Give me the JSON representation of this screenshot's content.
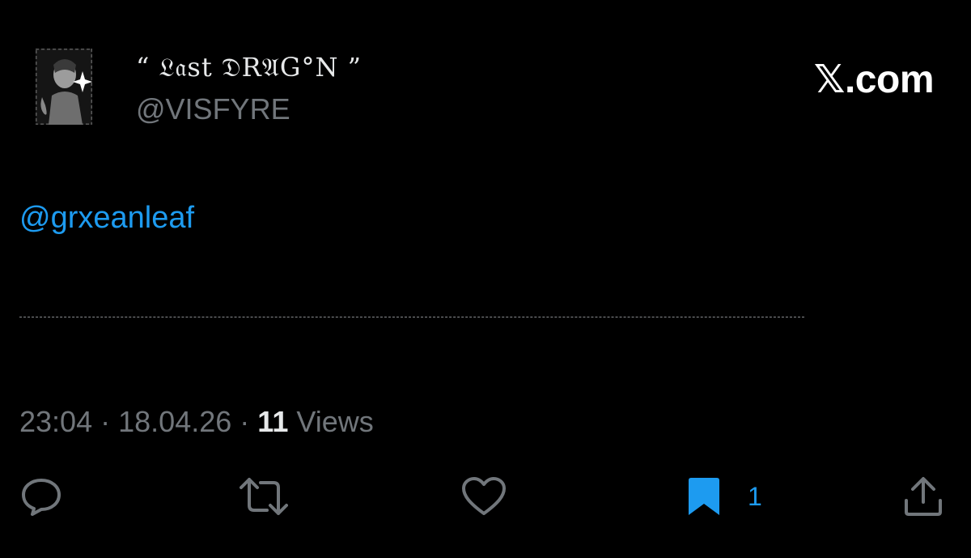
{
  "author": {
    "display_name": "“ 𝔏𝔞st 𝔇R𝔄G°N ”",
    "handle": "@VISFYRE"
  },
  "brand": "𝕏.com",
  "tweet": {
    "mention": "@grxeanleaf"
  },
  "meta": {
    "time": "23:04",
    "sep1": "·",
    "date": "18.04.26",
    "sep2": "·",
    "views_count": "11",
    "views_label": "Views"
  },
  "actions": {
    "reply_icon": "reply-icon",
    "retweet_icon": "retweet-icon",
    "like_icon": "heart-icon",
    "bookmark_icon": "bookmark-icon",
    "bookmark_count": "1",
    "share_icon": "share-icon"
  },
  "colors": {
    "background": "#000000",
    "text": "#e7e9ea",
    "secondary": "#71767b",
    "accent": "#1d9bf0"
  }
}
